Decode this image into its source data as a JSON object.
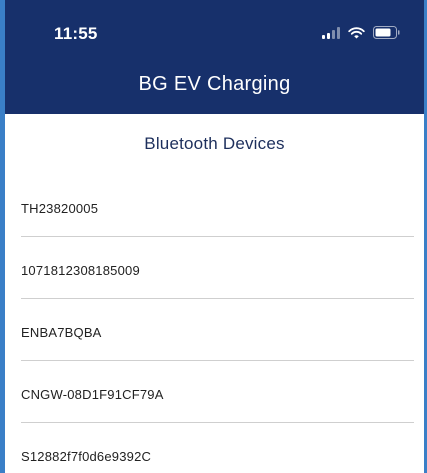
{
  "status_bar": {
    "time": "11:55",
    "icons": [
      "cellular-signal-icon",
      "wifi-icon",
      "battery-icon"
    ]
  },
  "header": {
    "title": "BG EV Charging",
    "background_color": "#17306b"
  },
  "section": {
    "title": "Bluetooth Devices"
  },
  "devices": [
    {
      "name": "TH23820005"
    },
    {
      "name": "1071812308185009"
    },
    {
      "name": "ENBA7BQBA"
    },
    {
      "name": "CNGW-08D1F91CF79A"
    },
    {
      "name": "S12882f7f0d6e9392C"
    }
  ]
}
